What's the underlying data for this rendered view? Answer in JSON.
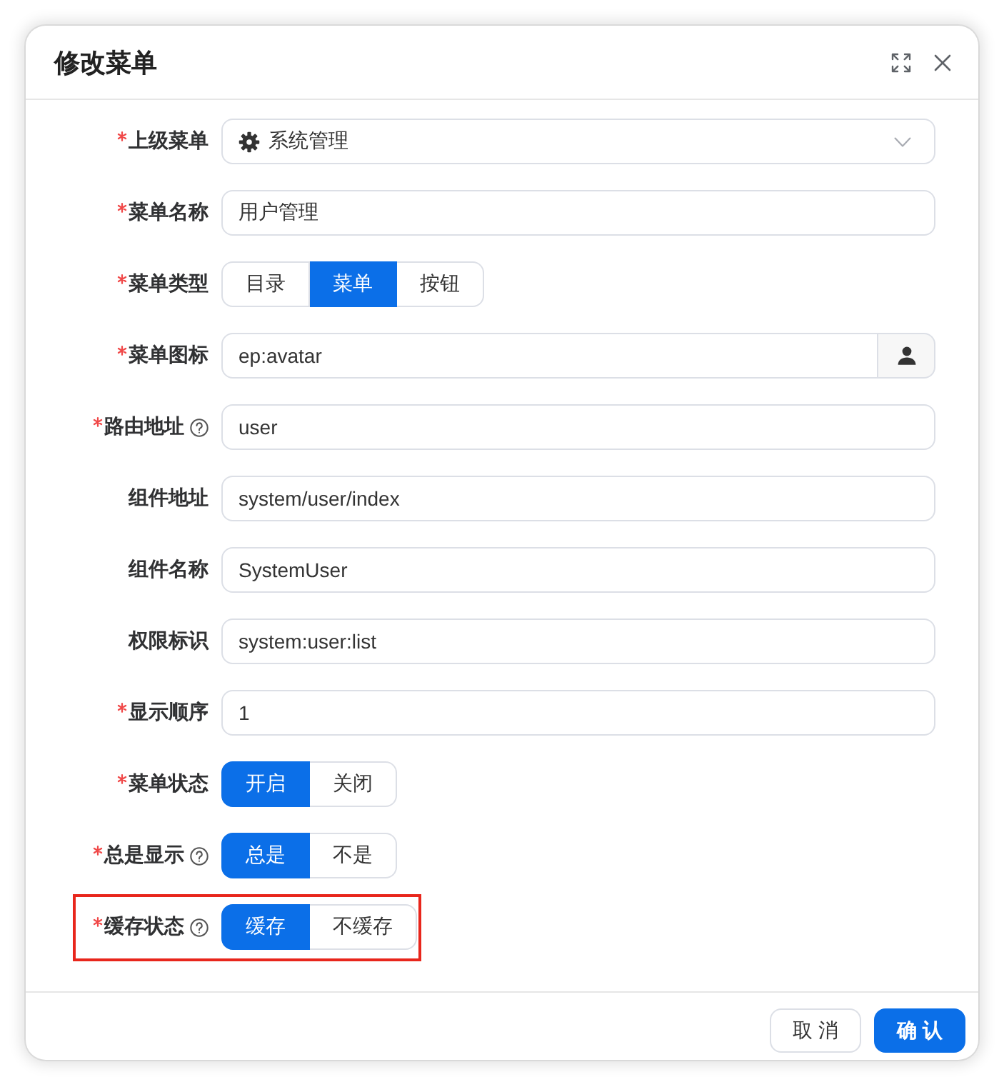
{
  "dialog": {
    "title": "修改菜单"
  },
  "form": {
    "fields": [
      {
        "kind": "select",
        "label": "上级菜单",
        "required": true,
        "help": false,
        "highlighted": false,
        "value": "系统管理"
      },
      {
        "kind": "text",
        "label": "菜单名称",
        "required": true,
        "help": false,
        "highlighted": false,
        "value": "用户管理"
      },
      {
        "kind": "radio",
        "label": "菜单类型",
        "required": true,
        "help": false,
        "highlighted": false,
        "options": [
          {
            "label": "目录",
            "selected": false
          },
          {
            "label": "菜单",
            "selected": true
          },
          {
            "label": "按钮",
            "selected": false
          }
        ]
      },
      {
        "kind": "icon-picker",
        "label": "菜单图标",
        "required": true,
        "help": false,
        "highlighted": false,
        "value": "ep:avatar"
      },
      {
        "kind": "text",
        "label": "路由地址",
        "required": true,
        "help": true,
        "highlighted": false,
        "value": "user"
      },
      {
        "kind": "text",
        "label": "组件地址",
        "required": false,
        "help": false,
        "highlighted": false,
        "value": "system/user/index"
      },
      {
        "kind": "text",
        "label": "组件名称",
        "required": false,
        "help": false,
        "highlighted": false,
        "value": "SystemUser"
      },
      {
        "kind": "text",
        "label": "权限标识",
        "required": false,
        "help": false,
        "highlighted": false,
        "value": "system:user:list"
      },
      {
        "kind": "text",
        "label": "显示顺序",
        "required": true,
        "help": false,
        "highlighted": false,
        "value": "1"
      },
      {
        "kind": "radio",
        "label": "菜单状态",
        "required": true,
        "help": false,
        "highlighted": false,
        "options": [
          {
            "label": "开启",
            "selected": true
          },
          {
            "label": "关闭",
            "selected": false
          }
        ]
      },
      {
        "kind": "radio",
        "label": "总是显示",
        "required": true,
        "help": true,
        "highlighted": false,
        "options": [
          {
            "label": "总是",
            "selected": true
          },
          {
            "label": "不是",
            "selected": false
          }
        ]
      },
      {
        "kind": "radio",
        "label": "缓存状态",
        "required": true,
        "help": true,
        "highlighted": true,
        "options": [
          {
            "label": "缓存",
            "selected": true
          },
          {
            "label": "不缓存",
            "selected": false
          }
        ]
      }
    ]
  },
  "footer": {
    "buttons": [
      {
        "label": "取 消",
        "kind": "default"
      },
      {
        "label": "确 认",
        "kind": "primary"
      }
    ]
  }
}
